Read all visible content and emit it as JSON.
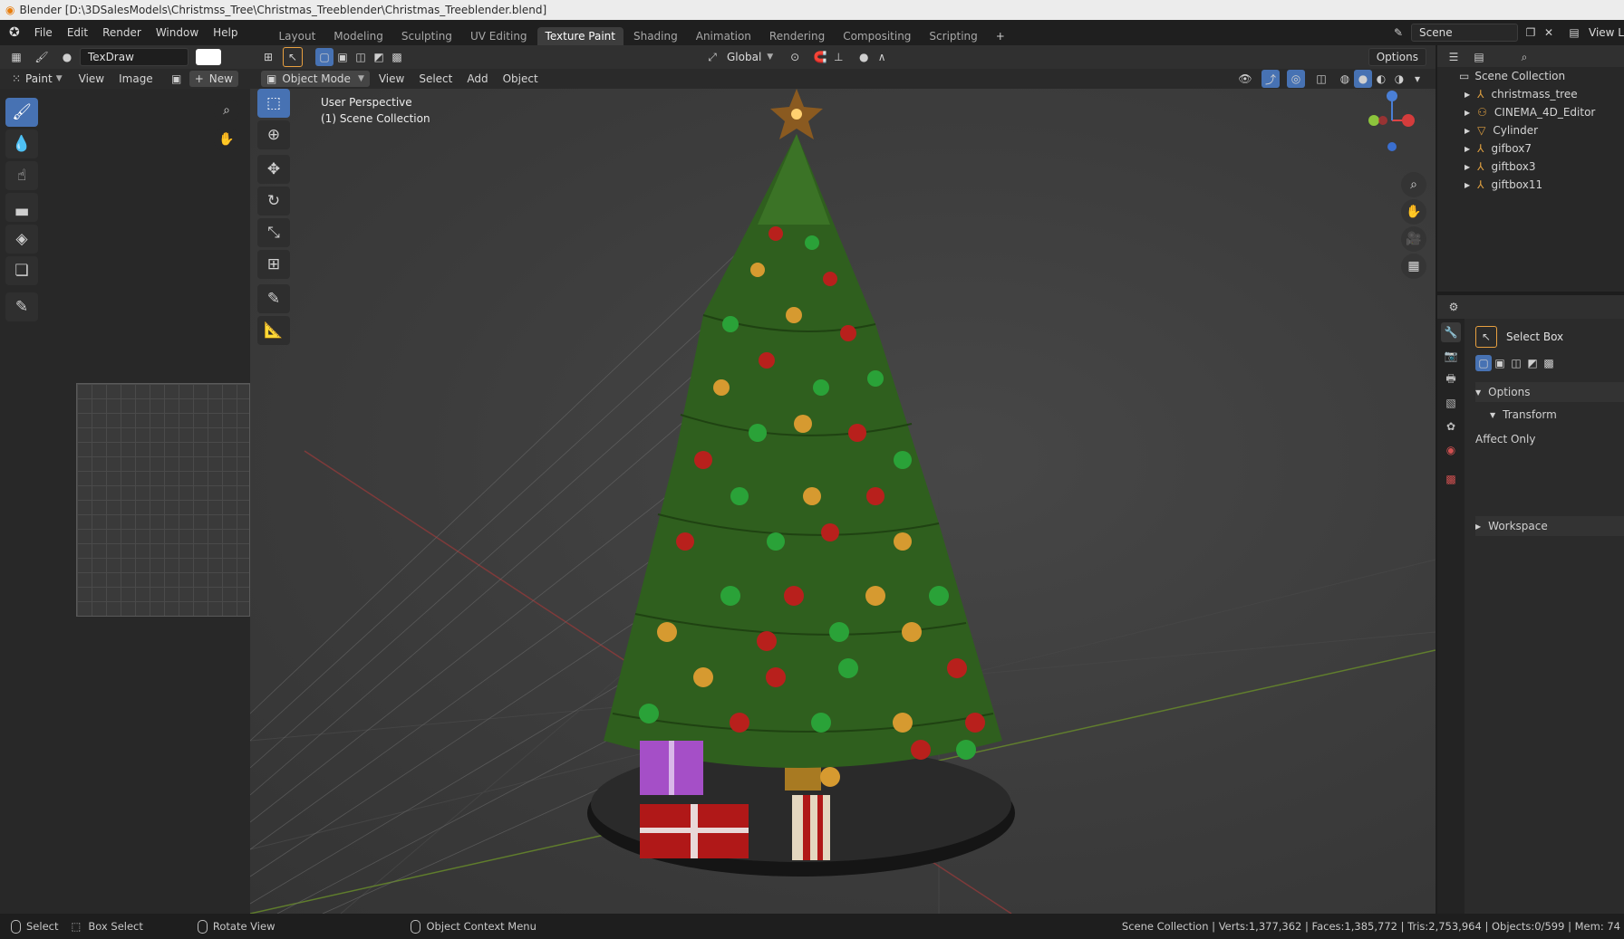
{
  "titlebar": {
    "text": "Blender [D:\\3DSalesModels\\Christmss_Tree\\Christmas_Treeblender\\Christmas_Treeblender.blend]"
  },
  "menu": [
    "File",
    "Edit",
    "Render",
    "Window",
    "Help"
  ],
  "workspaces": [
    "Layout",
    "Modeling",
    "Sculpting",
    "UV Editing",
    "Texture Paint",
    "Shading",
    "Animation",
    "Rendering",
    "Compositing",
    "Scripting"
  ],
  "active_workspace": "Texture Paint",
  "scene": {
    "name": "Scene",
    "view_layer": "View L"
  },
  "image_editor": {
    "brush_name": "TexDraw",
    "mode": "Paint",
    "menus": [
      "View",
      "Image"
    ],
    "new_label": "New"
  },
  "viewport": {
    "mode": "Object Mode",
    "menus": [
      "View",
      "Select",
      "Add",
      "Object"
    ],
    "overlay_line1": "User Perspective",
    "overlay_line2": "(1) Scene Collection",
    "orientation": "Global",
    "options_label": "Options"
  },
  "outliner": {
    "root": "Scene Collection",
    "items": [
      "christmass_tree",
      "CINEMA_4D_Editor",
      "Cylinder",
      "gifbox7",
      "giftbox3",
      "giftbox11"
    ]
  },
  "properties": {
    "tool_name": "Select Box",
    "options_label": "Options",
    "transform_label": "Transform",
    "affect_only_label": "Affect Only",
    "workspace_label": "Workspace"
  },
  "status": {
    "select": "Select",
    "box_select": "Box Select",
    "rotate": "Rotate View",
    "context": "Object Context Menu",
    "stats": "Scene Collection | Verts:1,377,362 | Faces:1,385,772 | Tris:2,753,964 | Objects:0/599 | Mem: 74"
  },
  "colors": {
    "accent": "#4772b3",
    "tree_green": "#2f5f1e",
    "ornament_red": "#b8201c",
    "ornament_green": "#2aa238",
    "ornament_gold": "#d69a30"
  }
}
